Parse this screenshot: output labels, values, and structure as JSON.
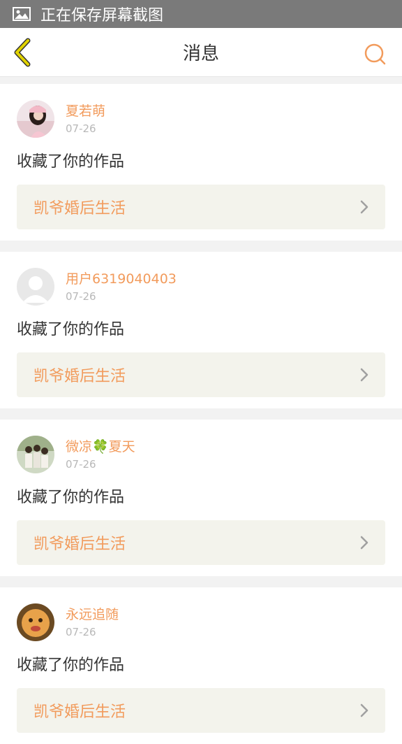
{
  "status_bar": {
    "text": "正在保存屏幕截图",
    "icon": "image-icon"
  },
  "header": {
    "title": "消息",
    "back_icon": "back-arrow-icon",
    "search_icon": "search-icon"
  },
  "colors": {
    "accent": "#f29b5c",
    "back_arrow": "#e0d200",
    "work_bg": "#f3f3ec"
  },
  "messages": [
    {
      "user": "夏若萌",
      "date": "07-26",
      "action": "收藏了你的作品",
      "work": "凯爷婚后生活"
    },
    {
      "user": "用户6319040403",
      "date": "07-26",
      "action": "收藏了你的作品",
      "work": "凯爷婚后生活"
    },
    {
      "user": "微凉🍀夏天",
      "date": "07-26",
      "action": "收藏了你的作品",
      "work": "凯爷婚后生活"
    },
    {
      "user": "永远追随",
      "date": "07-26",
      "action": "收藏了你的作品",
      "work": "凯爷婚后生活"
    }
  ]
}
